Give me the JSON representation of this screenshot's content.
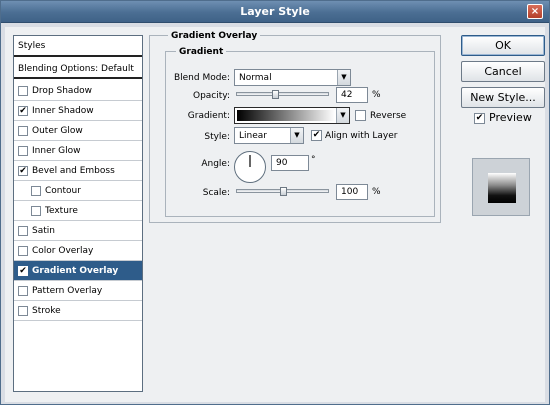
{
  "window": {
    "title": "Layer Style",
    "close_glyph": "×"
  },
  "styles_panel": {
    "header": "Styles",
    "blending_options": "Blending Options: Default",
    "items": [
      {
        "label": "Drop Shadow",
        "checked": false,
        "indent": false
      },
      {
        "label": "Inner Shadow",
        "checked": true,
        "indent": false
      },
      {
        "label": "Outer Glow",
        "checked": false,
        "indent": false
      },
      {
        "label": "Inner Glow",
        "checked": false,
        "indent": false
      },
      {
        "label": "Bevel and Emboss",
        "checked": true,
        "indent": false
      },
      {
        "label": "Contour",
        "checked": false,
        "indent": true
      },
      {
        "label": "Texture",
        "checked": false,
        "indent": true
      },
      {
        "label": "Satin",
        "checked": false,
        "indent": false
      },
      {
        "label": "Color Overlay",
        "checked": false,
        "indent": false
      },
      {
        "label": "Gradient Overlay",
        "checked": true,
        "indent": false,
        "selected": true
      },
      {
        "label": "Pattern Overlay",
        "checked": false,
        "indent": false
      },
      {
        "label": "Stroke",
        "checked": false,
        "indent": false
      }
    ]
  },
  "gradient_overlay": {
    "section_title": "Gradient Overlay",
    "group_title": "Gradient",
    "blend_mode": {
      "label": "Blend Mode:",
      "value": "Normal"
    },
    "opacity": {
      "label": "Opacity:",
      "value": "42",
      "unit": "%",
      "level": 0.42
    },
    "gradient": {
      "label": "Gradient:",
      "reverse_label": "Reverse",
      "reverse_checked": false
    },
    "style": {
      "label": "Style:",
      "value": "Linear",
      "align_label": "Align with Layer",
      "align_checked": true
    },
    "angle": {
      "label": "Angle:",
      "value": "90",
      "unit": "°"
    },
    "scale": {
      "label": "Scale:",
      "value": "100",
      "unit": "%",
      "level": 0.5
    }
  },
  "buttons": {
    "ok": "OK",
    "cancel": "Cancel",
    "new_style": "New Style...",
    "preview_label": "Preview",
    "preview_checked": true
  },
  "check_glyph": "✔",
  "dropdown_glyph": "▼"
}
